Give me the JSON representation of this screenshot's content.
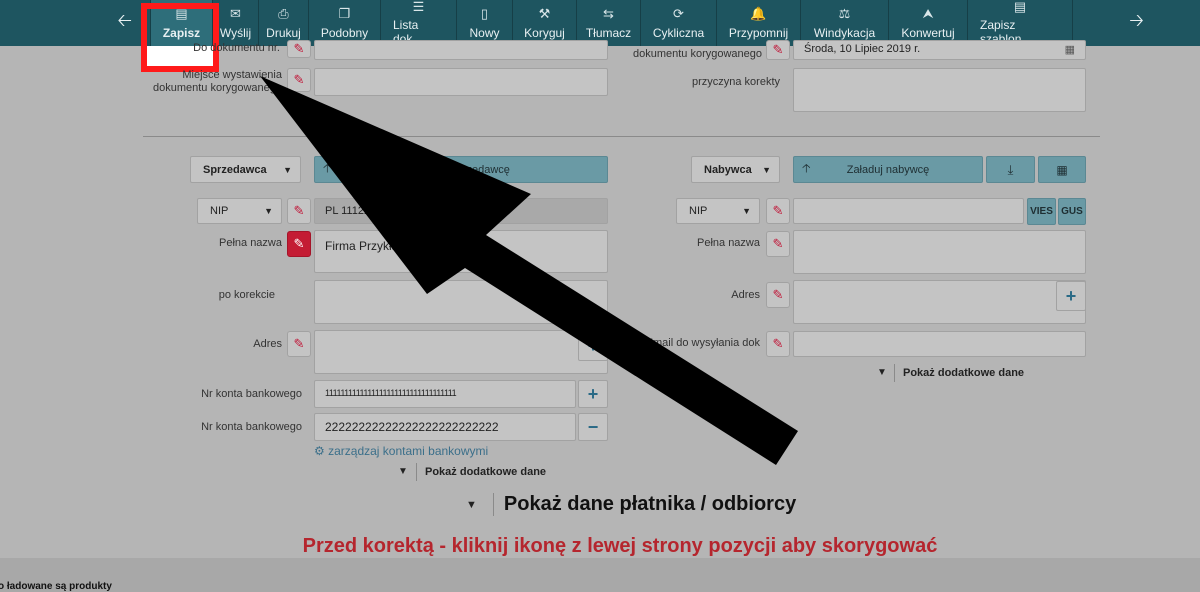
{
  "toolbar": {
    "prev_icon": "arrow-left-icon",
    "next_icon": "arrow-right-icon",
    "buttons": [
      {
        "label": "Zapisz",
        "icon": "save-icon",
        "glyph": "💾"
      },
      {
        "label": "Wyślij",
        "icon": "mail-icon",
        "glyph": "✉"
      },
      {
        "label": "Drukuj",
        "icon": "print-icon",
        "glyph": "⎙"
      },
      {
        "label": "Podobny",
        "icon": "copy-icon",
        "glyph": "❐"
      },
      {
        "label": "Lista dok.",
        "icon": "list-icon",
        "glyph": "☰"
      },
      {
        "label": "Nowy",
        "icon": "new-file-icon",
        "glyph": "▯"
      },
      {
        "label": "Koryguj",
        "icon": "tools-icon",
        "glyph": "⚒"
      },
      {
        "label": "Tłumacz",
        "icon": "swap-icon",
        "glyph": "⇆"
      },
      {
        "label": "Cykliczna",
        "icon": "cycle-icon",
        "glyph": "⟳"
      },
      {
        "label": "Przypomnij",
        "icon": "bell-icon",
        "glyph": "♪"
      },
      {
        "label": "Windykacja",
        "icon": "gavel-icon",
        "glyph": "⚖"
      },
      {
        "label": "Konwertuj",
        "icon": "upload-icon",
        "glyph": "↑"
      },
      {
        "label": "Zapisz szablon",
        "icon": "save-template-icon",
        "glyph": "💾"
      }
    ]
  },
  "top_form": {
    "doc_number_label": "Do dokumentu nr.",
    "issue_place_label": "Miejsce wystawienia dokumentu korygowanego",
    "corrected_doc_label": "dokumentu korygowanego",
    "corrected_date_value": "Środa, 10 Lipiec 2019 r.",
    "reason_label": "przyczyna korekty"
  },
  "seller": {
    "type_select": "Sprzedawca",
    "load_button": "Załaduj sprzedawcę",
    "id_type": "NIP",
    "nip_value": "PL 1112223344",
    "full_name_label": "Pełna nazwa",
    "full_name_value": "Firma Przykładowa Sp",
    "after_correction_label": "po korekcie",
    "address_label": "Adres",
    "bank_label_1": "Nr konta bankowego",
    "bank_value_1": "1111111111111111111111111111111111",
    "bank_label_2": "Nr konta bankowego",
    "bank_value_2": "22222222222222222222222222",
    "manage_accounts_link": "zarządzaj kontami bankowymi",
    "more_data": "Pokaż dodatkowe dane"
  },
  "buyer": {
    "type_select": "Nabywca",
    "load_button": "Załaduj nabywcę",
    "id_type": "NIP",
    "vies_button": "VIES",
    "gus_button": "GUS",
    "full_name_label": "Pełna nazwa",
    "address_label": "Adres",
    "email_label": "Email do wysyłania dok",
    "more_data": "Pokaż dodatkowe dane"
  },
  "payer_section": {
    "title": "Pokaż dane płatnika / odbiorcy"
  },
  "warning": {
    "text": "Przed korektą - kliknij ikonę z lewej strony pozycji aby skorygować"
  },
  "footer": {
    "status_text": "o ładowane są produkty"
  }
}
